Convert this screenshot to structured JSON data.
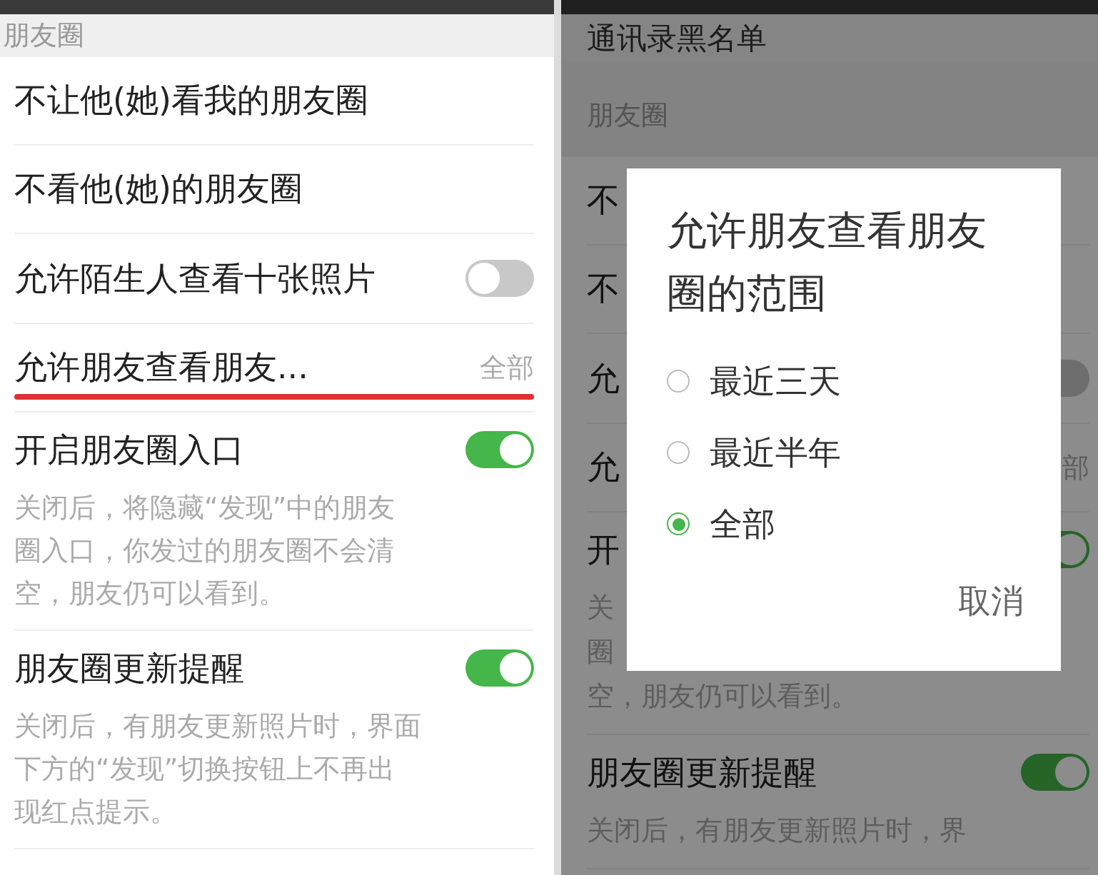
{
  "left_screen": {
    "rows": [
      {
        "kind": "header",
        "label": "朋友圈"
      },
      {
        "kind": "link",
        "label": "不让他(她)看我的朋友圈"
      },
      {
        "kind": "link",
        "label": "不看他(她)的朋友圈"
      },
      {
        "kind": "toggle",
        "label": "允许陌生人查看十张照片",
        "on": false
      },
      {
        "kind": "value",
        "label": "允许朋友查看朋友...",
        "value": "全部",
        "underlined": true
      },
      {
        "kind": "toggle",
        "label": "开启朋友圈入口",
        "on": true,
        "description_lines": [
          "关闭后，将隐藏“发现”中的朋友",
          "圈入口，你发过的朋友圈不会清",
          "空，朋友仍可以看到。"
        ]
      },
      {
        "kind": "toggle",
        "label": "朋友圈更新提醒",
        "on": true,
        "description_lines": [
          "关闭后，有朋友更新照片时，界面",
          "下方的“发现”切换按钮上不再出",
          "现红点提示。"
        ]
      }
    ]
  },
  "right_screen": {
    "rows": [
      {
        "kind": "link",
        "label": "通讯录黑名单"
      },
      {
        "kind": "header",
        "label": "朋友圈"
      },
      {
        "kind": "link",
        "label": "不"
      },
      {
        "kind": "link",
        "label": "不"
      },
      {
        "kind": "toggle",
        "label": "允",
        "on": false
      },
      {
        "kind": "value",
        "label": "允",
        "value": "部",
        "underlined": false
      },
      {
        "kind": "toggle",
        "label": "开",
        "on": true,
        "description_lines": [
          "关",
          "圈",
          "空，朋友仍可以看到。"
        ]
      },
      {
        "kind": "toggle",
        "label": "朋友圈更新提醒",
        "on": true,
        "description_lines": [
          "关闭后，有朋友更新照片时，界"
        ]
      }
    ],
    "dialog": {
      "title": "允许朋友查看朋友圈的范围",
      "options": [
        {
          "label": "最近三天",
          "selected": false
        },
        {
          "label": "最近半年",
          "selected": false
        },
        {
          "label": "全部",
          "selected": true
        }
      ],
      "cancel": "取消"
    }
  }
}
